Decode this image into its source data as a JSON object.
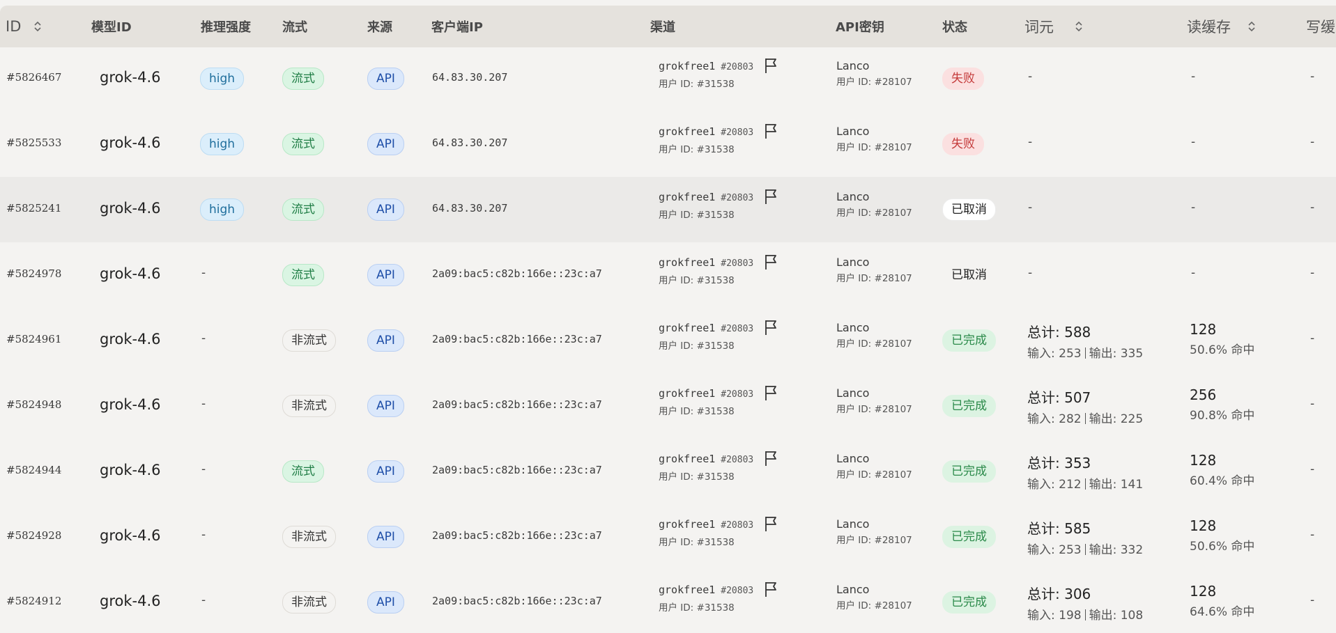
{
  "headers": {
    "id": "ID",
    "model": "模型ID",
    "effort": "推理强度",
    "stream": "流式",
    "source": "来源",
    "ip": "客户端IP",
    "channel": "渠道",
    "apikey": "API密钥",
    "status": "状态",
    "tokens": "词元",
    "cache_read": "读缓存",
    "cache_write": "写缓"
  },
  "colors": {
    "header_bg": "#e5e2dd",
    "page_bg": "#f4f3f1",
    "fail": "#c43a3a",
    "done": "#2b8a4a",
    "stream_green": "#1f7d45",
    "api_blue": "#1f4fa8",
    "effort_blue": "#1f6e9c"
  },
  "icons": {
    "sort": "sort-updown-icon",
    "flag": "flag-icon"
  },
  "labels": {
    "total_prefix": "总计:",
    "input_prefix": "输入:",
    "output_prefix": "输出:",
    "hit_suffix": "命中"
  },
  "rows": [
    {
      "id": "#5826467",
      "model": "grok-4.6",
      "effort": "high",
      "stream": "流式",
      "stream_type": "stream",
      "source": "API",
      "ip": "64.83.30.207",
      "channel": "grokfree1",
      "channel_no": "#20803",
      "channel_user": "用户 ID: #31538",
      "key_name": "Lanco",
      "key_user": "用户 ID: #28107",
      "status": "失败",
      "status_type": "fail",
      "tokens": "-",
      "cache_read": "-",
      "cache_write": "-"
    },
    {
      "id": "#5825533",
      "model": "grok-4.6",
      "effort": "high",
      "stream": "流式",
      "stream_type": "stream",
      "source": "API",
      "ip": "64.83.30.207",
      "channel": "grokfree1",
      "channel_no": "#20803",
      "channel_user": "用户 ID: #31538",
      "key_name": "Lanco",
      "key_user": "用户 ID: #28107",
      "status": "失败",
      "status_type": "fail",
      "tokens": "-",
      "cache_read": "-",
      "cache_write": "-"
    },
    {
      "id": "#5825241",
      "model": "grok-4.6",
      "effort": "high",
      "stream": "流式",
      "stream_type": "stream",
      "source": "API",
      "ip": "64.83.30.207",
      "channel": "grokfree1",
      "channel_no": "#20803",
      "channel_user": "用户 ID: #31538",
      "key_name": "Lanco",
      "key_user": "用户 ID: #28107",
      "status": "已取消",
      "status_type": "cancel",
      "tokens": "-",
      "cache_read": "-",
      "cache_write": "-"
    },
    {
      "id": "#5824978",
      "model": "grok-4.6",
      "effort": "-",
      "stream": "流式",
      "stream_type": "stream",
      "source": "API",
      "ip": "2a09:bac5:c82b:166e::23c:a7",
      "channel": "grokfree1",
      "channel_no": "#20803",
      "channel_user": "用户 ID: #31538",
      "key_name": "Lanco",
      "key_user": "用户 ID: #28107",
      "status": "已取消",
      "status_type": "cancel-plain",
      "tokens": "-",
      "cache_read": "-",
      "cache_write": "-"
    },
    {
      "id": "#5824961",
      "model": "grok-4.6",
      "effort": "-",
      "stream": "非流式",
      "stream_type": "nonstream",
      "source": "API",
      "ip": "2a09:bac5:c82b:166e::23c:a7",
      "channel": "grokfree1",
      "channel_no": "#20803",
      "channel_user": "用户 ID: #31538",
      "key_name": "Lanco",
      "key_user": "用户 ID: #28107",
      "status": "已完成",
      "status_type": "done",
      "total": "588",
      "input": "253",
      "output": "335",
      "cache_read": "128",
      "hit": "50.6%",
      "cache_write": "-"
    },
    {
      "id": "#5824948",
      "model": "grok-4.6",
      "effort": "-",
      "stream": "非流式",
      "stream_type": "nonstream",
      "source": "API",
      "ip": "2a09:bac5:c82b:166e::23c:a7",
      "channel": "grokfree1",
      "channel_no": "#20803",
      "channel_user": "用户 ID: #31538",
      "key_name": "Lanco",
      "key_user": "用户 ID: #28107",
      "status": "已完成",
      "status_type": "done",
      "total": "507",
      "input": "282",
      "output": "225",
      "cache_read": "256",
      "hit": "90.8%",
      "cache_write": "-"
    },
    {
      "id": "#5824944",
      "model": "grok-4.6",
      "effort": "-",
      "stream": "流式",
      "stream_type": "stream",
      "source": "API",
      "ip": "2a09:bac5:c82b:166e::23c:a7",
      "channel": "grokfree1",
      "channel_no": "#20803",
      "channel_user": "用户 ID: #31538",
      "key_name": "Lanco",
      "key_user": "用户 ID: #28107",
      "status": "已完成",
      "status_type": "done",
      "total": "353",
      "input": "212",
      "output": "141",
      "cache_read": "128",
      "hit": "60.4%",
      "cache_write": "-"
    },
    {
      "id": "#5824928",
      "model": "grok-4.6",
      "effort": "-",
      "stream": "非流式",
      "stream_type": "nonstream",
      "source": "API",
      "ip": "2a09:bac5:c82b:166e::23c:a7",
      "channel": "grokfree1",
      "channel_no": "#20803",
      "channel_user": "用户 ID: #31538",
      "key_name": "Lanco",
      "key_user": "用户 ID: #28107",
      "status": "已完成",
      "status_type": "done",
      "total": "585",
      "input": "253",
      "output": "332",
      "cache_read": "128",
      "hit": "50.6%",
      "cache_write": "-"
    },
    {
      "id": "#5824912",
      "model": "grok-4.6",
      "effort": "-",
      "stream": "非流式",
      "stream_type": "nonstream",
      "source": "API",
      "ip": "2a09:bac5:c82b:166e::23c:a7",
      "channel": "grokfree1",
      "channel_no": "#20803",
      "channel_user": "用户 ID: #31538",
      "key_name": "Lanco",
      "key_user": "用户 ID: #28107",
      "status": "已完成",
      "status_type": "done",
      "total": "306",
      "input": "198",
      "output": "108",
      "cache_read": "128",
      "hit": "64.6%",
      "cache_write": "-"
    }
  ]
}
